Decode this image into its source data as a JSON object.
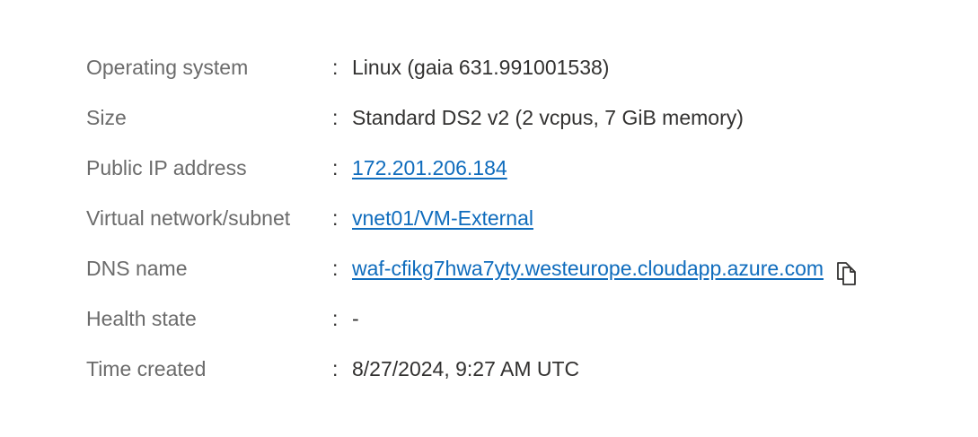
{
  "properties": [
    {
      "label": "Operating system",
      "separator": ":",
      "value": "Linux (gaia 631.991001538)",
      "is_link": false
    },
    {
      "label": "Size",
      "separator": ":",
      "value": "Standard DS2 v2 (2 vcpus, 7 GiB memory)",
      "is_link": false
    },
    {
      "label": "Public IP address",
      "separator": ":",
      "value": "172.201.206.184",
      "is_link": true
    },
    {
      "label": "Virtual network/subnet",
      "separator": ":",
      "value": "vnet01/VM-External",
      "is_link": true
    },
    {
      "label": "DNS name",
      "separator": ":",
      "value": "waf-cfikg7hwa7yty.westeurope.cloudapp.azure.com",
      "is_link": true,
      "copy_icon": "copy-icon"
    },
    {
      "label": "Health state",
      "separator": ":",
      "value": "-",
      "is_link": false
    },
    {
      "label": "Time created",
      "separator": ":",
      "value": "8/27/2024, 9:27 AM UTC",
      "is_link": false
    }
  ],
  "colors": {
    "label": "#6b6b6b",
    "value": "#323130",
    "link": "#0f6cbd"
  }
}
